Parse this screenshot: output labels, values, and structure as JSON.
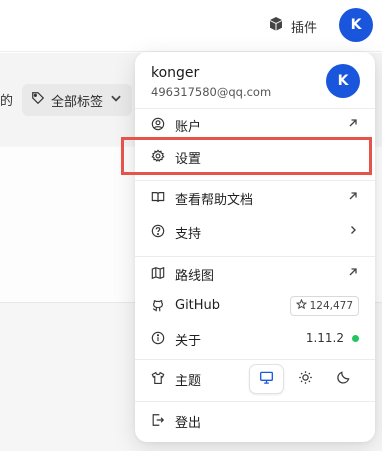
{
  "topbar": {
    "plugin_label": "插件",
    "avatar_letter": "K"
  },
  "background": {
    "left_snippet": "的",
    "tag_filter_label": "全部标签"
  },
  "user": {
    "name": "konger",
    "email": "496317580@qq.com",
    "avatar_letter": "K"
  },
  "menu": {
    "account_label": "账户",
    "settings_label": "设置",
    "help_docs_label": "查看帮助文档",
    "support_label": "支持",
    "roadmap_label": "路线图",
    "github_label": "GitHub",
    "github_stars": "124,477",
    "about_label": "关于",
    "version": "1.11.2",
    "theme_label": "主题",
    "logout_label": "登出"
  },
  "theme": {
    "options": [
      "system",
      "light",
      "dark"
    ],
    "selected": "system"
  },
  "colors": {
    "avatar": "#1a56db",
    "status_ok": "#22c55e",
    "highlight": "#e5534b"
  }
}
